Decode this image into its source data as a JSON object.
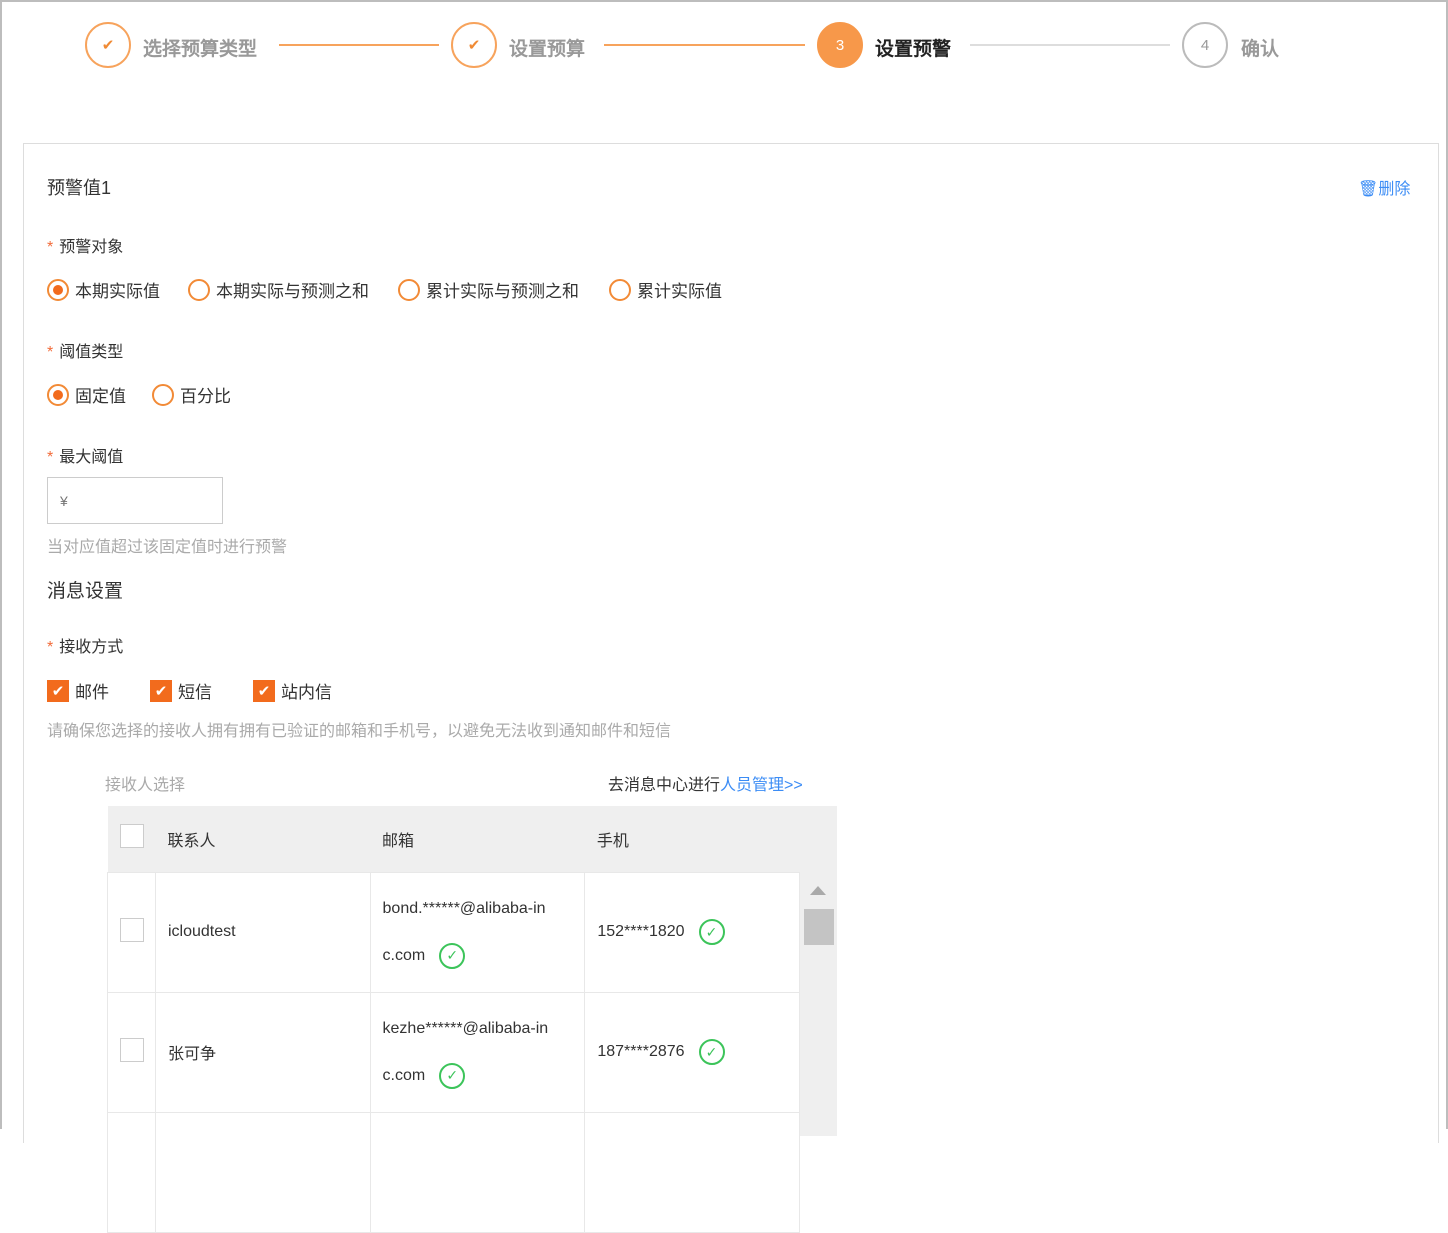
{
  "steps": [
    {
      "label": "选择预算类型",
      "state": "done"
    },
    {
      "label": "设置预算",
      "state": "done"
    },
    {
      "label": "设置预警",
      "number": "3",
      "state": "active"
    },
    {
      "label": "确认",
      "number": "4",
      "state": "pending"
    }
  ],
  "colors": {
    "accent": "#f26b1d",
    "link": "#3b8cf5",
    "success": "#3cc45a"
  },
  "card": {
    "title": "预警值1",
    "delete_label": "删除"
  },
  "target": {
    "label": "预警对象",
    "options": [
      "本期实际值",
      "本期实际与预测之和",
      "累计实际与预测之和",
      "累计实际值"
    ],
    "selected": "本期实际值"
  },
  "threshold_type": {
    "label": "阈值类型",
    "options": [
      "固定值",
      "百分比"
    ],
    "selected": "固定值"
  },
  "max_threshold": {
    "label": "最大阈值",
    "placeholder": "¥",
    "hint": "当对应值超过该固定值时进行预警"
  },
  "message": {
    "section_title": "消息设置",
    "receive_label": "接收方式",
    "methods": [
      "邮件",
      "短信",
      "站内信"
    ],
    "hint": "请确保您选择的接收人拥有拥有已验证的邮箱和手机号，以避免无法收到通知邮件和短信",
    "recipient_label": "接收人选择",
    "manage_prefix": "去消息中心进行",
    "manage_link": "人员管理>>"
  },
  "table": {
    "headers": [
      "联系人",
      "邮箱",
      "手机"
    ],
    "rows": [
      {
        "name": "icloudtest",
        "email_1": "bond.******@alibaba-in",
        "email_2": "c.com",
        "phone": "152****1820"
      },
      {
        "name": "张可争",
        "email_1": "kezhe******@alibaba-in",
        "email_2": "c.com",
        "phone": "187****2876"
      }
    ]
  }
}
